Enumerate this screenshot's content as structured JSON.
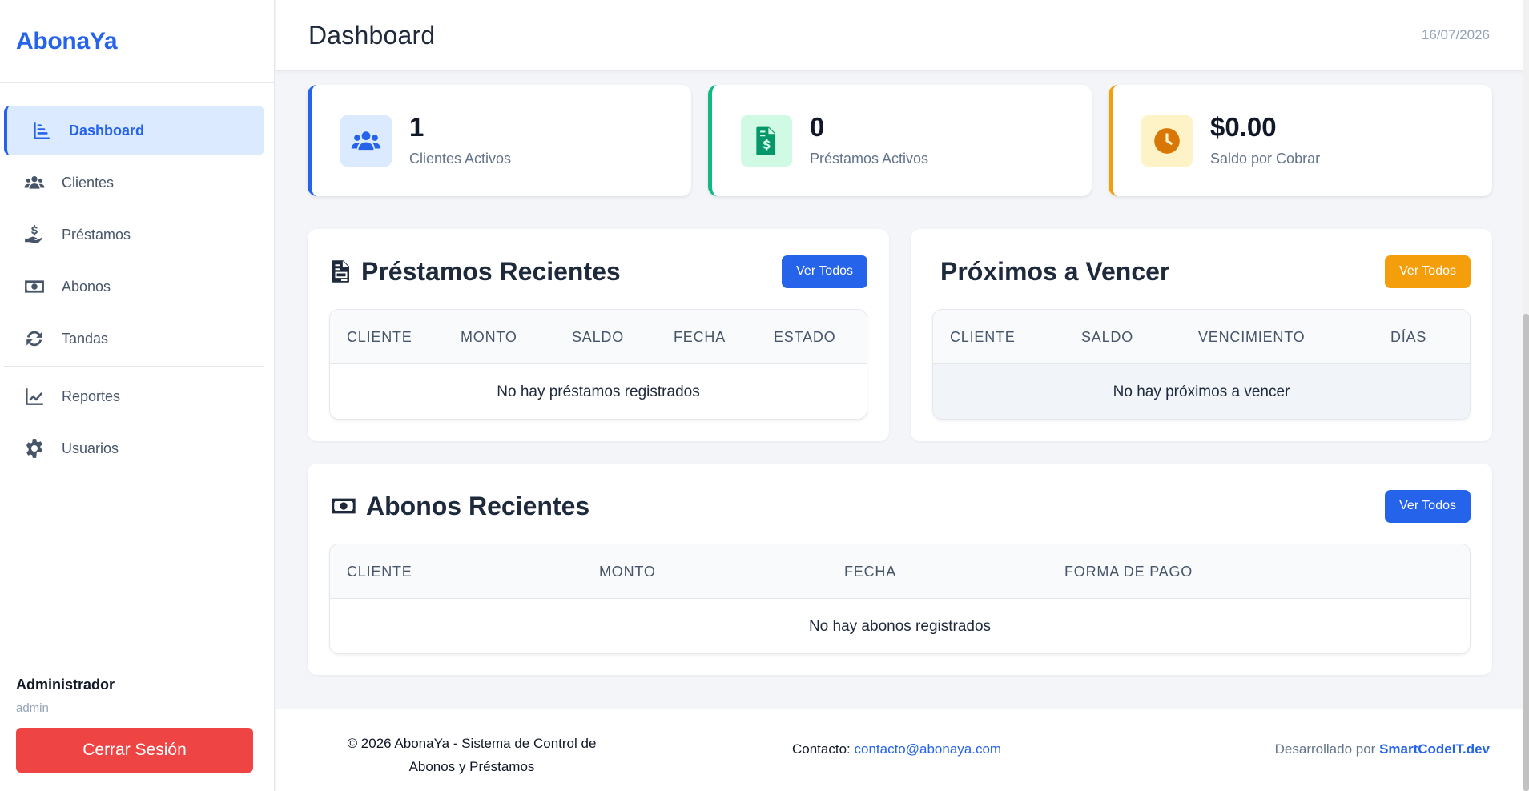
{
  "app": {
    "brand": "AbonaYa"
  },
  "sidebar": {
    "items": [
      {
        "label": "Dashboard",
        "icon": "chart-bar-icon"
      },
      {
        "label": "Clientes",
        "icon": "users-icon"
      },
      {
        "label": "Préstamos",
        "icon": "hand-dollar-icon"
      },
      {
        "label": "Abonos",
        "icon": "money-bill-icon"
      },
      {
        "label": "Tandas",
        "icon": "sync-icon"
      },
      {
        "label": "Reportes",
        "icon": "line-chart-icon"
      },
      {
        "label": "Usuarios",
        "icon": "gear-icon"
      }
    ],
    "active": "Dashboard",
    "user": {
      "name": "Administrador",
      "role": "admin"
    },
    "logout_label": "Cerrar Sesión"
  },
  "header": {
    "title": "Dashboard",
    "date": "16/07/2026"
  },
  "stats": [
    {
      "value": "1",
      "label": "Clientes Activos",
      "accent": "#2563eb"
    },
    {
      "value": "0",
      "label": "Préstamos Activos",
      "accent": "#10b981"
    },
    {
      "value": "$0.00",
      "label": "Saldo por Cobrar",
      "accent": "#f59e0b"
    }
  ],
  "panels": {
    "prestamos": {
      "title": "Préstamos Recientes",
      "button": "Ver Todos",
      "columns": [
        "CLIENTE",
        "MONTO",
        "SALDO",
        "FECHA",
        "ESTADO"
      ],
      "empty": "No hay préstamos registrados"
    },
    "vencer": {
      "title": "Próximos a Vencer",
      "button": "Ver Todos",
      "columns": [
        "CLIENTE",
        "SALDO",
        "VENCIMIENTO",
        "DÍAS"
      ],
      "empty": "No hay próximos a vencer"
    },
    "abonos": {
      "title": "Abonos Recientes",
      "button": "Ver Todos",
      "columns": [
        "CLIENTE",
        "MONTO",
        "FECHA",
        "FORMA DE PAGO"
      ],
      "empty": "No hay abonos registrados"
    }
  },
  "footer": {
    "copyright": "© 2026 AbonaYa - Sistema de Control de Abonos y Préstamos",
    "contact_label": "Contacto:",
    "contact_email": "contacto@abonaya.com",
    "dev_label": "Desarrollado por",
    "dev_name": "SmartCodeIT.dev"
  },
  "colors": {
    "primary": "#2563eb",
    "success": "#10b981",
    "warning": "#f59e0b",
    "danger": "#ef4444"
  }
}
